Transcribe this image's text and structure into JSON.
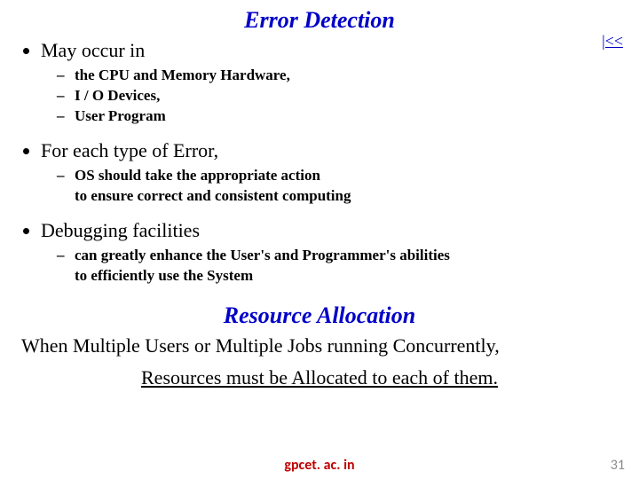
{
  "heading1": "Error Detection",
  "back_link": "|<<",
  "bullets": [
    {
      "text": "May occur in",
      "sub": [
        "the CPU and Memory Hardware,",
        "I / O Devices,",
        "User Program"
      ]
    },
    {
      "text": "For each type of Error,",
      "sub": [
        "OS should take the appropriate action\nto ensure correct and consistent computing"
      ]
    },
    {
      "text": "Debugging facilities",
      "sub": [
        "can greatly enhance the User's and Programmer's abilities\nto efficiently use the System"
      ]
    }
  ],
  "heading2": "Resource Allocation",
  "bottom_line1": "When Multiple Users or Multiple Jobs running Concurrently,",
  "bottom_line2": "Resources must be Allocated to each of them.",
  "footer_center": "gpcet. ac. in",
  "page_number": "31"
}
